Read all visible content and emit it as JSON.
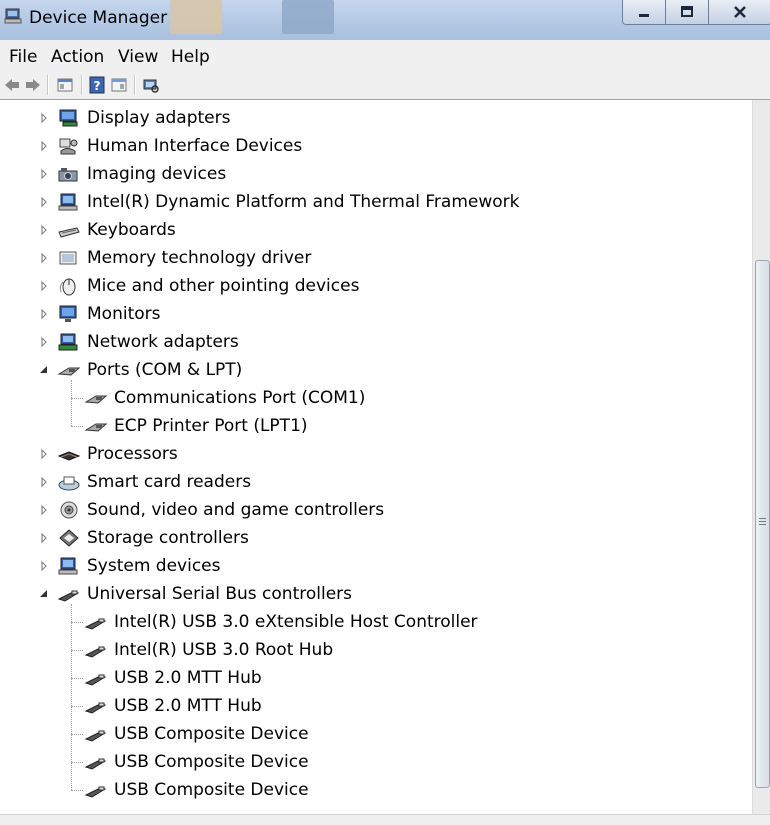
{
  "window": {
    "title": "Device Manager"
  },
  "menu": [
    "File",
    "Action",
    "View",
    "Help"
  ],
  "toolbar": [
    "back-arrow-icon",
    "forward-arrow-icon",
    "properties-icon",
    "help-icon",
    "update-driver-icon",
    "scan-hardware-icon"
  ],
  "tree": [
    {
      "label": "Display adapters",
      "icon": "display-adapter-icon",
      "expanded": false
    },
    {
      "label": "Human Interface Devices",
      "icon": "hid-icon",
      "expanded": false
    },
    {
      "label": "Imaging devices",
      "icon": "camera-icon",
      "expanded": false
    },
    {
      "label": "Intel(R) Dynamic Platform and Thermal Framework",
      "icon": "system-device-icon",
      "expanded": false
    },
    {
      "label": "Keyboards",
      "icon": "keyboard-icon",
      "expanded": false
    },
    {
      "label": "Memory technology driver",
      "icon": "memory-icon",
      "expanded": false
    },
    {
      "label": "Mice and other pointing devices",
      "icon": "mouse-icon",
      "expanded": false
    },
    {
      "label": "Monitors",
      "icon": "monitor-icon",
      "expanded": false
    },
    {
      "label": "Network adapters",
      "icon": "network-adapter-icon",
      "expanded": false
    },
    {
      "label": "Ports (COM & LPT)",
      "icon": "port-icon",
      "expanded": true,
      "children": [
        "Communications Port (COM1)",
        "ECP Printer Port (LPT1)"
      ]
    },
    {
      "label": "Processors",
      "icon": "processor-icon",
      "expanded": false
    },
    {
      "label": "Smart card readers",
      "icon": "smart-card-icon",
      "expanded": false
    },
    {
      "label": "Sound, video and game controllers",
      "icon": "speaker-icon",
      "expanded": false
    },
    {
      "label": "Storage controllers",
      "icon": "storage-icon",
      "expanded": false
    },
    {
      "label": "System devices",
      "icon": "system-device-icon",
      "expanded": false
    },
    {
      "label": "Universal Serial Bus controllers",
      "icon": "usb-icon",
      "expanded": true,
      "children": [
        "Intel(R) USB 3.0 eXtensible Host Controller",
        "Intel(R) USB 3.0 Root Hub",
        "USB 2.0 MTT Hub",
        "USB 2.0 MTT Hub",
        "USB Composite Device",
        "USB Composite Device",
        "USB Composite Device"
      ]
    }
  ]
}
